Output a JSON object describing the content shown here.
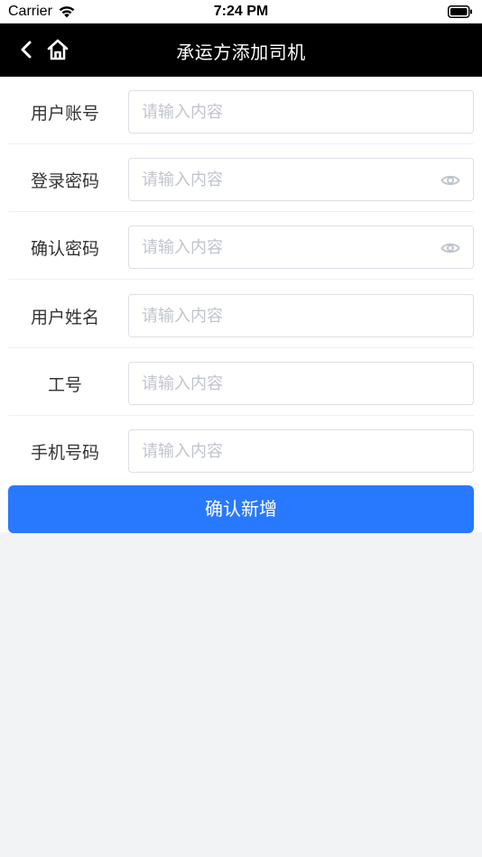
{
  "status_bar": {
    "carrier": "Carrier",
    "time": "7:24 PM"
  },
  "nav": {
    "title": "承运方添加司机",
    "back_icon": "chevron-left-icon",
    "home_icon": "home-icon"
  },
  "form": {
    "fields": [
      {
        "label": "用户账号",
        "placeholder": "请输入内容",
        "value": "",
        "has_eye": false
      },
      {
        "label": "登录密码",
        "placeholder": "请输入内容",
        "value": "",
        "has_eye": true
      },
      {
        "label": "确认密码",
        "placeholder": "请输入内容",
        "value": "",
        "has_eye": true
      },
      {
        "label": "用户姓名",
        "placeholder": "请输入内容",
        "value": "",
        "has_eye": false
      },
      {
        "label": "工号",
        "placeholder": "请输入内容",
        "value": "",
        "has_eye": false
      },
      {
        "label": "手机号码",
        "placeholder": "请输入内容",
        "value": "",
        "has_eye": false
      }
    ]
  },
  "submit": {
    "label": "确认新增"
  },
  "colors": {
    "nav_bg": "#000000",
    "accent": "#2979ff",
    "page_bg": "#f2f3f5",
    "placeholder": "#c0c4cc"
  }
}
